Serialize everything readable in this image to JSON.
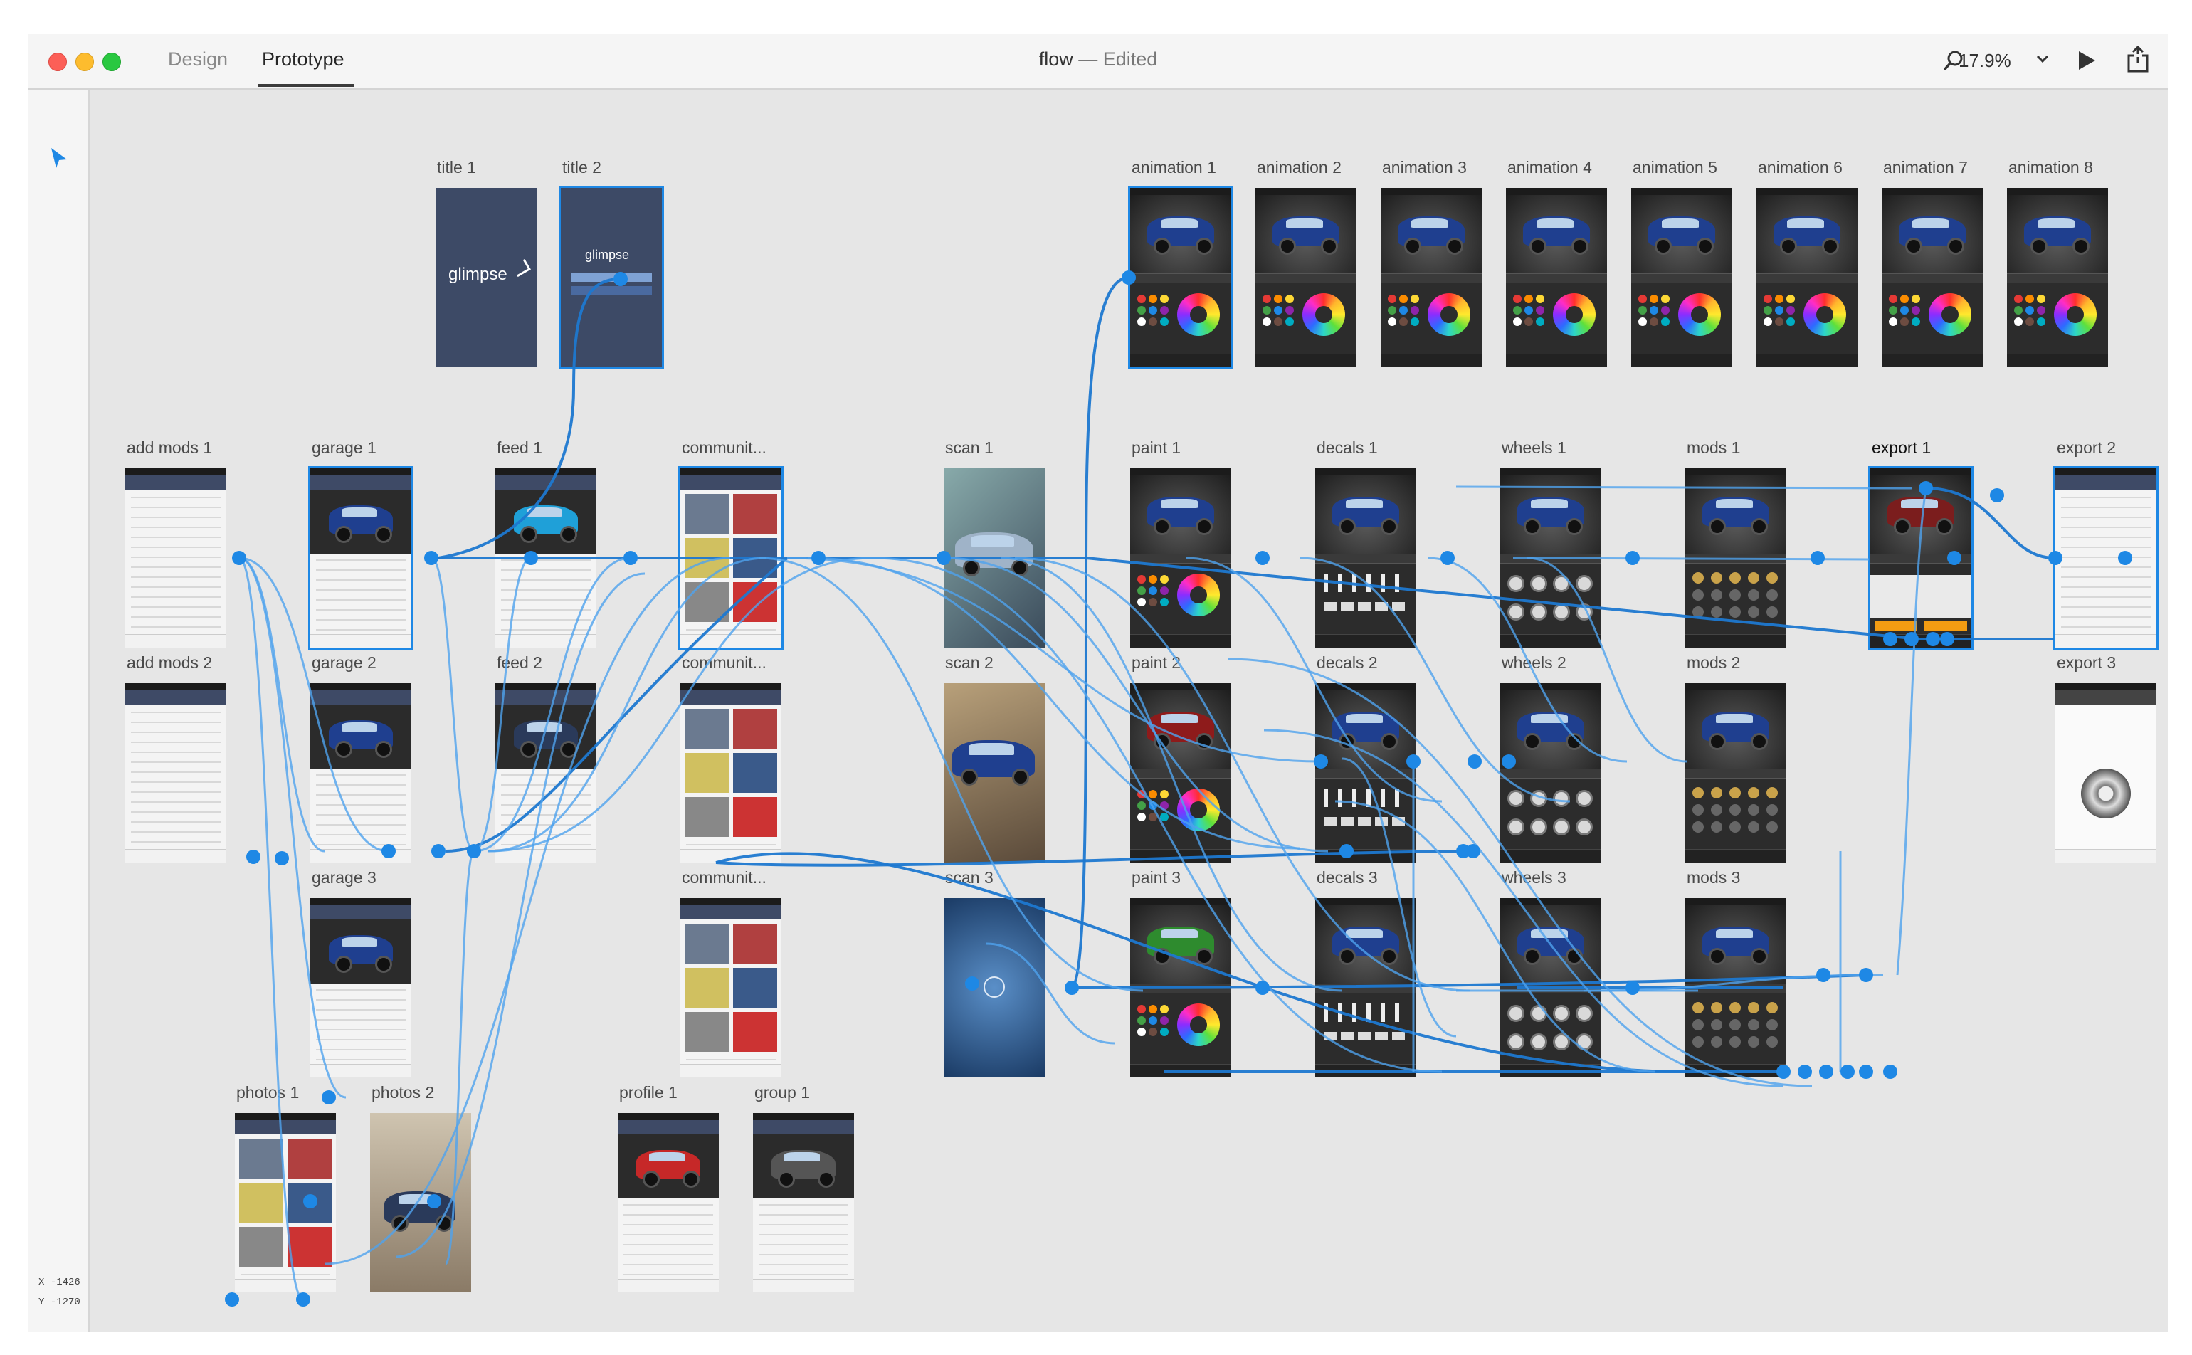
{
  "window": {
    "tabs": [
      {
        "label": "Design",
        "active": false
      },
      {
        "label": "Prototype",
        "active": true
      }
    ],
    "title": "flow",
    "separator": "—",
    "status": "Edited",
    "zoom": "17.9%",
    "icons": [
      "search-icon",
      "chevron-down-icon",
      "play-icon",
      "share-icon"
    ]
  },
  "leftbar": {
    "tool_icon": "select-arrow-icon",
    "coord_x": "X  -1426",
    "coord_y": "Y  -1270"
  },
  "colors": {
    "canvas": "#e6e6e6",
    "connector": "#1e88e5",
    "screen_dark": "#2c2c2c",
    "header_navy": "#3e4a66",
    "title_bg": "#3d4a66"
  },
  "artboards": {
    "title1": "title 1",
    "title2": "title 2",
    "anim1": "animation 1",
    "anim2": "animation 2",
    "anim3": "animation 3",
    "anim4": "animation 4",
    "anim5": "animation 5",
    "anim6": "animation 6",
    "anim7": "animation 7",
    "anim8": "animation 8",
    "addmods1": "add mods 1",
    "garage1": "garage 1",
    "feed1": "feed 1",
    "comm1": "communit...",
    "scan1": "scan 1",
    "paint1": "paint 1",
    "decals1": "decals 1",
    "wheels1": "wheels 1",
    "mods1": "mods 1",
    "export1": "export 1",
    "export2": "export 2",
    "addmods2": "add mods 2",
    "garage2": "garage 2",
    "feed2": "feed 2",
    "comm2": "communit...",
    "scan2": "scan 2",
    "paint2": "paint 2",
    "decals2": "decals 2",
    "wheels2": "wheels 2",
    "mods2": "mods 2",
    "export3": "export 3",
    "garage3": "garage 3",
    "comm3": "communit...",
    "scan3": "scan 3",
    "paint3": "paint 3",
    "decals3": "decals 3",
    "wheels3": "wheels 3",
    "mods3": "mods 3",
    "photos1": "photos 1",
    "photos2": "photos 2",
    "profile1": "profile 1",
    "group1": "group 1"
  },
  "logo_text": "glimpse"
}
